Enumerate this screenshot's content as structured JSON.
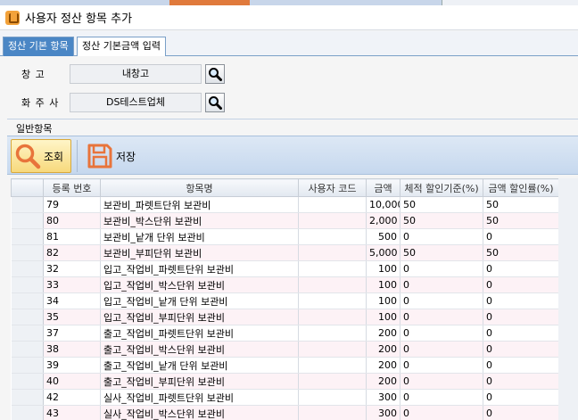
{
  "window": {
    "title": "사용자 정산 항목 추가"
  },
  "tabs": [
    {
      "label": "정산 기본 항목"
    },
    {
      "label": "정산 기본금액 입력"
    }
  ],
  "form": {
    "warehouse_label": "창 고",
    "warehouse_value": "내창고",
    "shipper_label": "화 주 사",
    "shipper_value": "DS테스트업체"
  },
  "group": {
    "label": "일반항목"
  },
  "toolbar": {
    "query_label": "조회",
    "save_label": "저장"
  },
  "grid": {
    "columns": [
      "",
      "등록 번호",
      "항목명",
      "사용자 코드",
      "금액",
      "체적 할인기준(%)",
      "금액 할인률(%)"
    ],
    "rows": [
      [
        "",
        "79",
        "보관비_파렛트단위 보관비",
        "",
        "10,000",
        "50",
        "50"
      ],
      [
        "",
        "80",
        "보관비_박스단위 보관비",
        "",
        "2,000",
        "50",
        "50"
      ],
      [
        "",
        "81",
        "보관비_낱개 단위 보관비",
        "",
        "500",
        "0",
        "0"
      ],
      [
        "",
        "82",
        "보관비_부피단위 보관비",
        "",
        "5,000",
        "50",
        "50"
      ],
      [
        "",
        "32",
        "입고_작업비_파렛트단위 보관비",
        "",
        "100",
        "0",
        "0"
      ],
      [
        "",
        "33",
        "입고_작업비_박스단위 보관비",
        "",
        "100",
        "0",
        "0"
      ],
      [
        "",
        "34",
        "입고_작업비_낱개 단위 보관비",
        "",
        "100",
        "0",
        "0"
      ],
      [
        "",
        "35",
        "입고_작업비_부피단위 보관비",
        "",
        "100",
        "0",
        "0"
      ],
      [
        "",
        "37",
        "출고_작업비_파렛트단위 보관비",
        "",
        "200",
        "0",
        "0"
      ],
      [
        "",
        "38",
        "출고_작업비_박스단위 보관비",
        "",
        "200",
        "0",
        "0"
      ],
      [
        "",
        "39",
        "출고_작업비_낱개 단위 보관비",
        "",
        "200",
        "0",
        "0"
      ],
      [
        "",
        "40",
        "출고_작업비_부피단위 보관비",
        "",
        "200",
        "0",
        "0"
      ],
      [
        "",
        "42",
        "실사_작업비_파렛트단위 보관비",
        "",
        "300",
        "0",
        "0"
      ],
      [
        "",
        "43",
        "실사_작업비_박스단위 보관비",
        "",
        "300",
        "0",
        "0"
      ]
    ]
  },
  "colors": {
    "tab_inactive_bg": "#4a86c5",
    "toolbar_bg": "#c6d8ee",
    "query_button_bg": "#f7d97c",
    "row_alt_bg": "#fdf2f6",
    "save_icon_color": "#e8743b"
  },
  "icons": {
    "app": "app-icon",
    "search": "search-icon",
    "query": "magnifier-icon",
    "save": "floppy-disk-icon"
  }
}
